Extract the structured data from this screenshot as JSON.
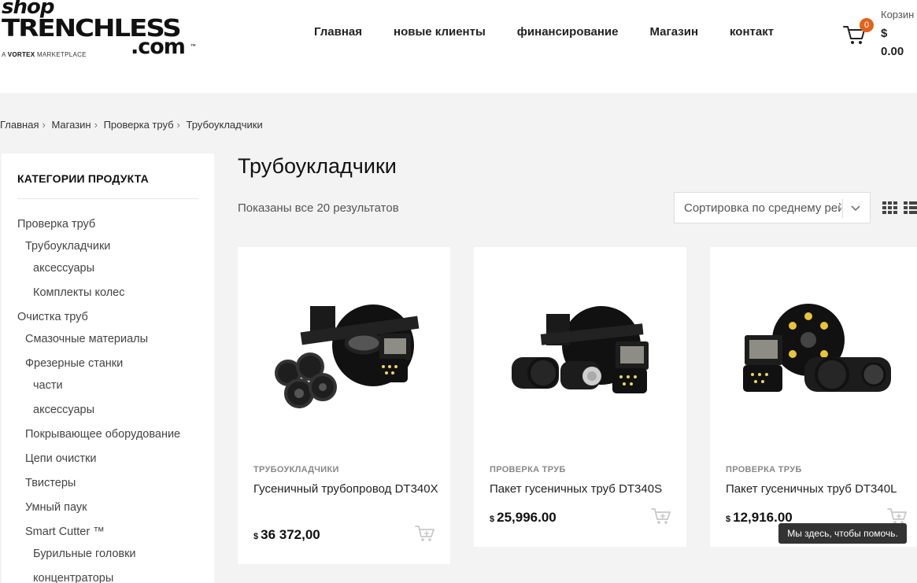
{
  "logo": {
    "line1": "shop",
    "line2": "TRENCHLESS",
    "line3": ".com",
    "tm": "™",
    "tagline_prefix": "A ",
    "tagline_brand": "VORTEX",
    "tagline_suffix": " MARKETPLACE"
  },
  "nav": {
    "items": [
      "Главная",
      "новые клиенты",
      "финансирование",
      "Магазин",
      "контакт"
    ]
  },
  "cart": {
    "count": "0",
    "label": "Корзин",
    "currency": "$",
    "total": "0.00"
  },
  "breadcrumb": {
    "items": [
      "Главная",
      "Магазин",
      "Проверка труб",
      "Трубоукладчики"
    ],
    "separator": "›"
  },
  "sidebar": {
    "title": "КАТЕГОРИИ ПРОДУКТА",
    "categories": [
      {
        "label": "Проверка труб",
        "level": 0
      },
      {
        "label": "Трубоукладчики",
        "level": 1
      },
      {
        "label": "аксессуары",
        "level": 2
      },
      {
        "label": "Комплекты колес",
        "level": 2
      },
      {
        "label": "Очистка труб",
        "level": 0
      },
      {
        "label": "Смазочные материалы",
        "level": 1
      },
      {
        "label": "Фрезерные станки",
        "level": 1
      },
      {
        "label": "части",
        "level": 2
      },
      {
        "label": "аксессуары",
        "level": 2
      },
      {
        "label": "Покрывающее оборудование",
        "level": 1
      },
      {
        "label": "Цепи очистки",
        "level": 1
      },
      {
        "label": "Твистеры",
        "level": 1
      },
      {
        "label": "Умный паук",
        "level": 1
      },
      {
        "label": "Smart Cutter ™",
        "level": 1
      },
      {
        "label": "Бурильные головки",
        "level": 2
      },
      {
        "label": "концентраторы",
        "level": 2
      }
    ]
  },
  "main": {
    "title": "Трубоукладчики",
    "result_count": "Показаны все 20 результатов",
    "sort_label": "Сортировка по среднему рейтингу"
  },
  "products": [
    {
      "category": "ТРУБОУКЛАДЧИКИ",
      "name": "Гусеничный трубопровод DT340X",
      "currency": "$",
      "price": "36 372,00"
    },
    {
      "category": "ПРОВЕРКА ТРУБ",
      "name": "Пакет гусеничных труб DT340S",
      "currency": "$",
      "price": "25,996.00"
    },
    {
      "category": "ПРОВЕРКА ТРУБ",
      "name": "Пакет гусеничных труб DT340L",
      "currency": "$",
      "price": "12,916.00"
    }
  ],
  "tooltip": "Мы здесь, чтобы помочь.",
  "colors": {
    "accent": "#e2621b",
    "background": "#f3f3f3",
    "card": "#ffffff",
    "icon_gray": "#c8c8c8"
  },
  "icons": {
    "cart": "cart-icon",
    "chevron": "chevron-down-icon",
    "grid": "grid-view-icon",
    "list": "list-view-icon",
    "add_to_cart": "add-to-cart-icon"
  }
}
